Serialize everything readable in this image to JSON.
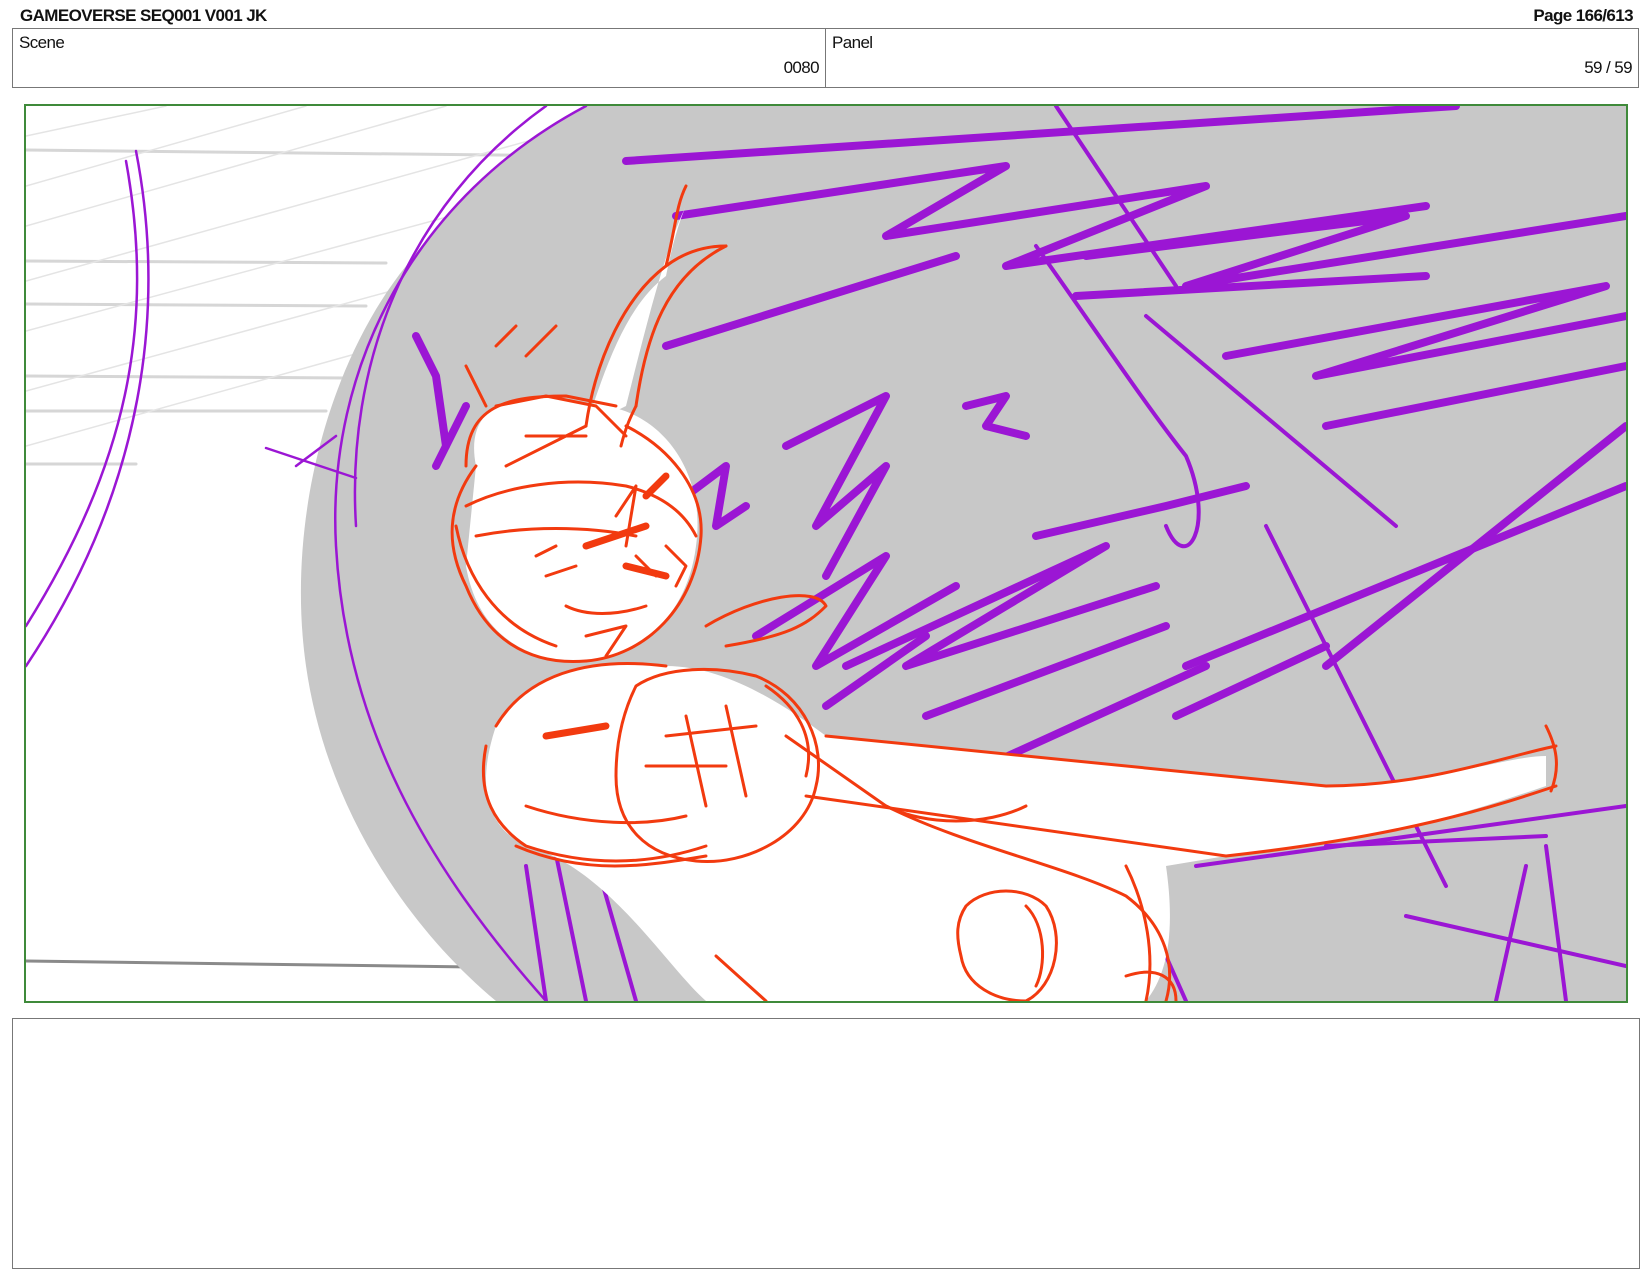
{
  "header": {
    "title": "GAMEOVERSE SEQ001 V001 JK",
    "page": "Page 166/613"
  },
  "scene": {
    "label": "Scene",
    "value": "0080"
  },
  "panel": {
    "label": "Panel",
    "value": "59 / 59"
  },
  "artwork": {
    "description_icon": "storyboard-sketch",
    "colors": {
      "frame_border": "#3f8a3a",
      "shadow_fill": "#c8c8c8",
      "purple_stroke": "#9b16d4",
      "red_stroke": "#f23a0f",
      "speed_lines": "#d4d4d4"
    }
  },
  "notes": {
    "text": ""
  }
}
